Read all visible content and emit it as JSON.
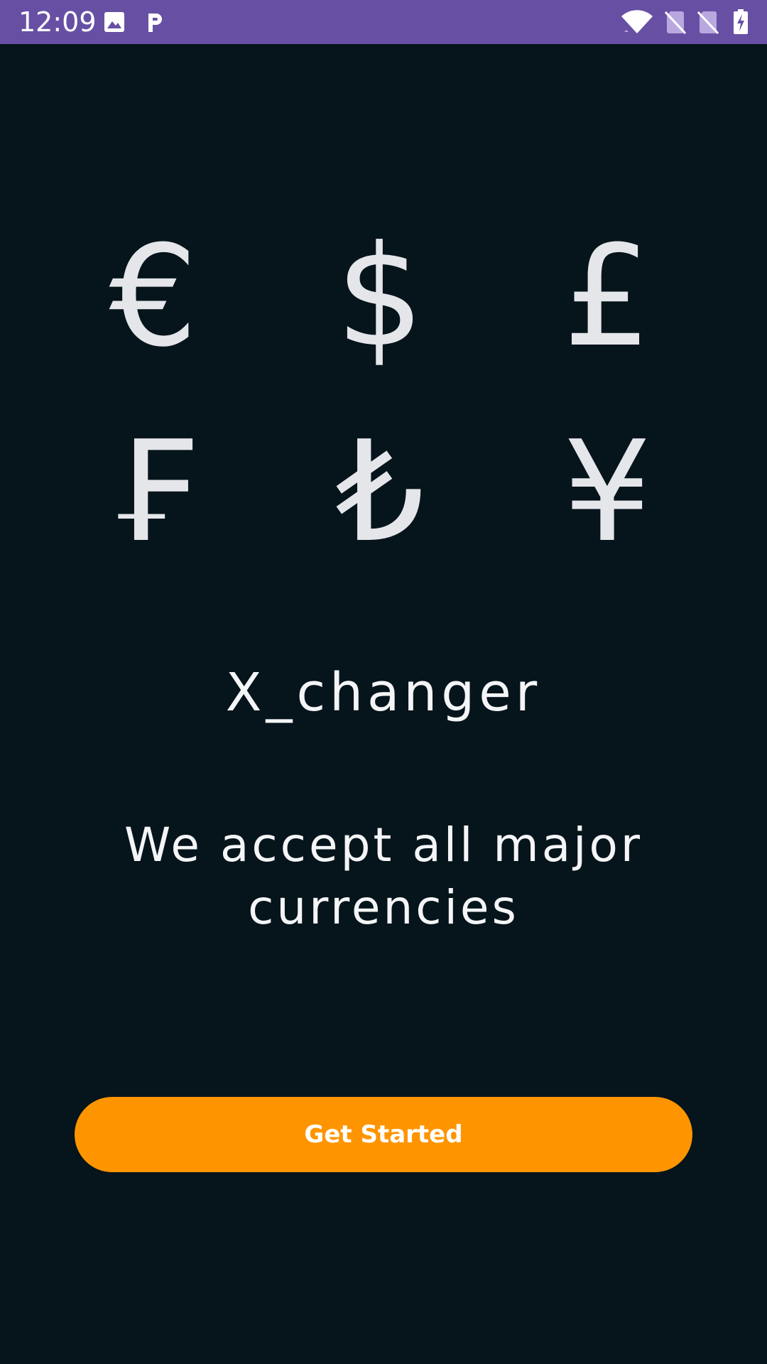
{
  "status_bar": {
    "time": "12:09",
    "icons": [
      "image-icon",
      "parking-app-icon",
      "wifi-icon",
      "no-sim-icon",
      "no-sim-icon",
      "battery-charging-icon"
    ],
    "background_color": "#6750a4"
  },
  "currencies": [
    {
      "name": "euro",
      "symbol": "€"
    },
    {
      "name": "dollar",
      "symbol": "$"
    },
    {
      "name": "pound",
      "symbol": "£"
    },
    {
      "name": "franc",
      "symbol": "₣"
    },
    {
      "name": "lira",
      "symbol": "₺"
    },
    {
      "name": "yen",
      "symbol": "¥"
    }
  ],
  "app_title": "X_changer",
  "tagline": "We accept all major currencies",
  "cta": {
    "label": "Get Started",
    "color": "#fe9500"
  },
  "colors": {
    "background": "#06141b",
    "symbol": "#e4e6ea",
    "text": "#f4f5f7"
  }
}
